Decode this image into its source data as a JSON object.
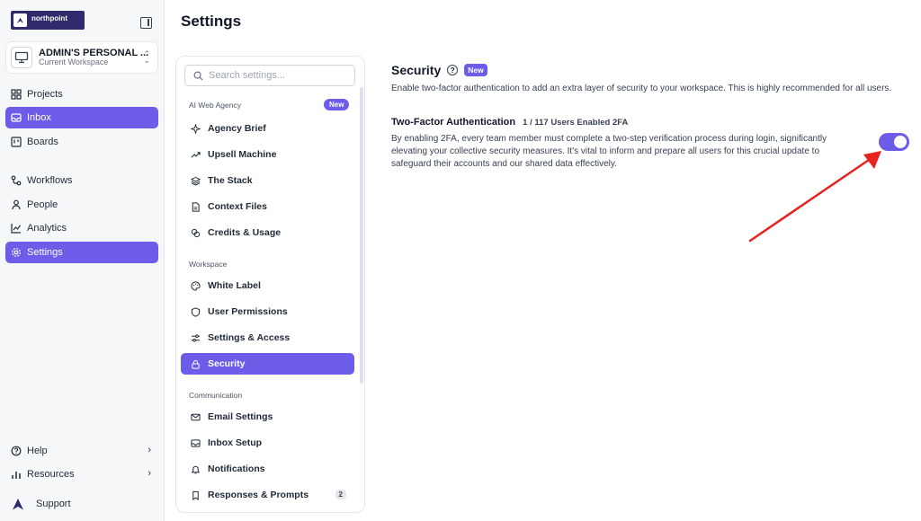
{
  "sidebar": {
    "logo_text": "northpoint",
    "workspace": {
      "name": "ADMIN'S PERSONAL ...",
      "subtitle": "Current Workspace"
    },
    "nav": [
      {
        "label": "Projects",
        "icon": "grid-icon"
      },
      {
        "label": "Inbox",
        "icon": "inbox-icon"
      },
      {
        "label": "Boards",
        "icon": "board-icon"
      },
      {
        "label": "Workflows",
        "icon": "workflow-icon"
      },
      {
        "label": "People",
        "icon": "person-icon"
      },
      {
        "label": "Analytics",
        "icon": "analytics-icon"
      },
      {
        "label": "Settings",
        "icon": "gear-icon",
        "active": true
      }
    ],
    "footer": [
      {
        "label": "Help",
        "icon": "help-icon"
      },
      {
        "label": "Resources",
        "icon": "resources-icon"
      },
      {
        "label": "Support",
        "icon": "support-logo-icon"
      }
    ]
  },
  "header": {
    "title": "Settings"
  },
  "settings_menu": {
    "search_placeholder": "Search settings...",
    "groups": [
      {
        "label": "AI Web Agency",
        "badge": "New",
        "items": [
          {
            "label": "Agency Brief",
            "icon": "sparkle-icon"
          },
          {
            "label": "Upsell Machine",
            "icon": "trend-icon"
          },
          {
            "label": "The Stack",
            "icon": "layers-icon"
          },
          {
            "label": "Context Files",
            "icon": "file-icon"
          },
          {
            "label": "Credits & Usage",
            "icon": "coins-icon"
          }
        ]
      },
      {
        "label": "Workspace",
        "items": [
          {
            "label": "White Label",
            "icon": "palette-icon"
          },
          {
            "label": "User Permissions",
            "icon": "shield-icon"
          },
          {
            "label": "Settings & Access",
            "icon": "sliders-icon"
          },
          {
            "label": "Security",
            "icon": "lock-icon",
            "active": true
          }
        ]
      },
      {
        "label": "Communication",
        "items": [
          {
            "label": "Email Settings",
            "icon": "mail-icon"
          },
          {
            "label": "Inbox Setup",
            "icon": "inbox-icon"
          },
          {
            "label": "Notifications",
            "icon": "bell-icon"
          },
          {
            "label": "Responses & Prompts",
            "icon": "bookmark-icon",
            "count": "2"
          }
        ]
      }
    ]
  },
  "security": {
    "title": "Security",
    "badge": "New",
    "help_glyph": "?",
    "description": "Enable two-factor authentication to add an extra layer of security to your workspace. This is highly recommended for all users.",
    "tfa": {
      "title": "Two-Factor Authentication",
      "count": "1 / 117 Users Enabled 2FA",
      "description": "By enabling 2FA, every team member must complete a two-step verification process during login, significantly elevating your collective security measures. It's vital to inform and prepare all users for this crucial update to safeguard their accounts and our shared data effectively.",
      "enabled": true
    }
  },
  "colors": {
    "accent": "#6c5ce7",
    "arrow": "#e8231f",
    "logo_bg": "#2f2a6b"
  }
}
